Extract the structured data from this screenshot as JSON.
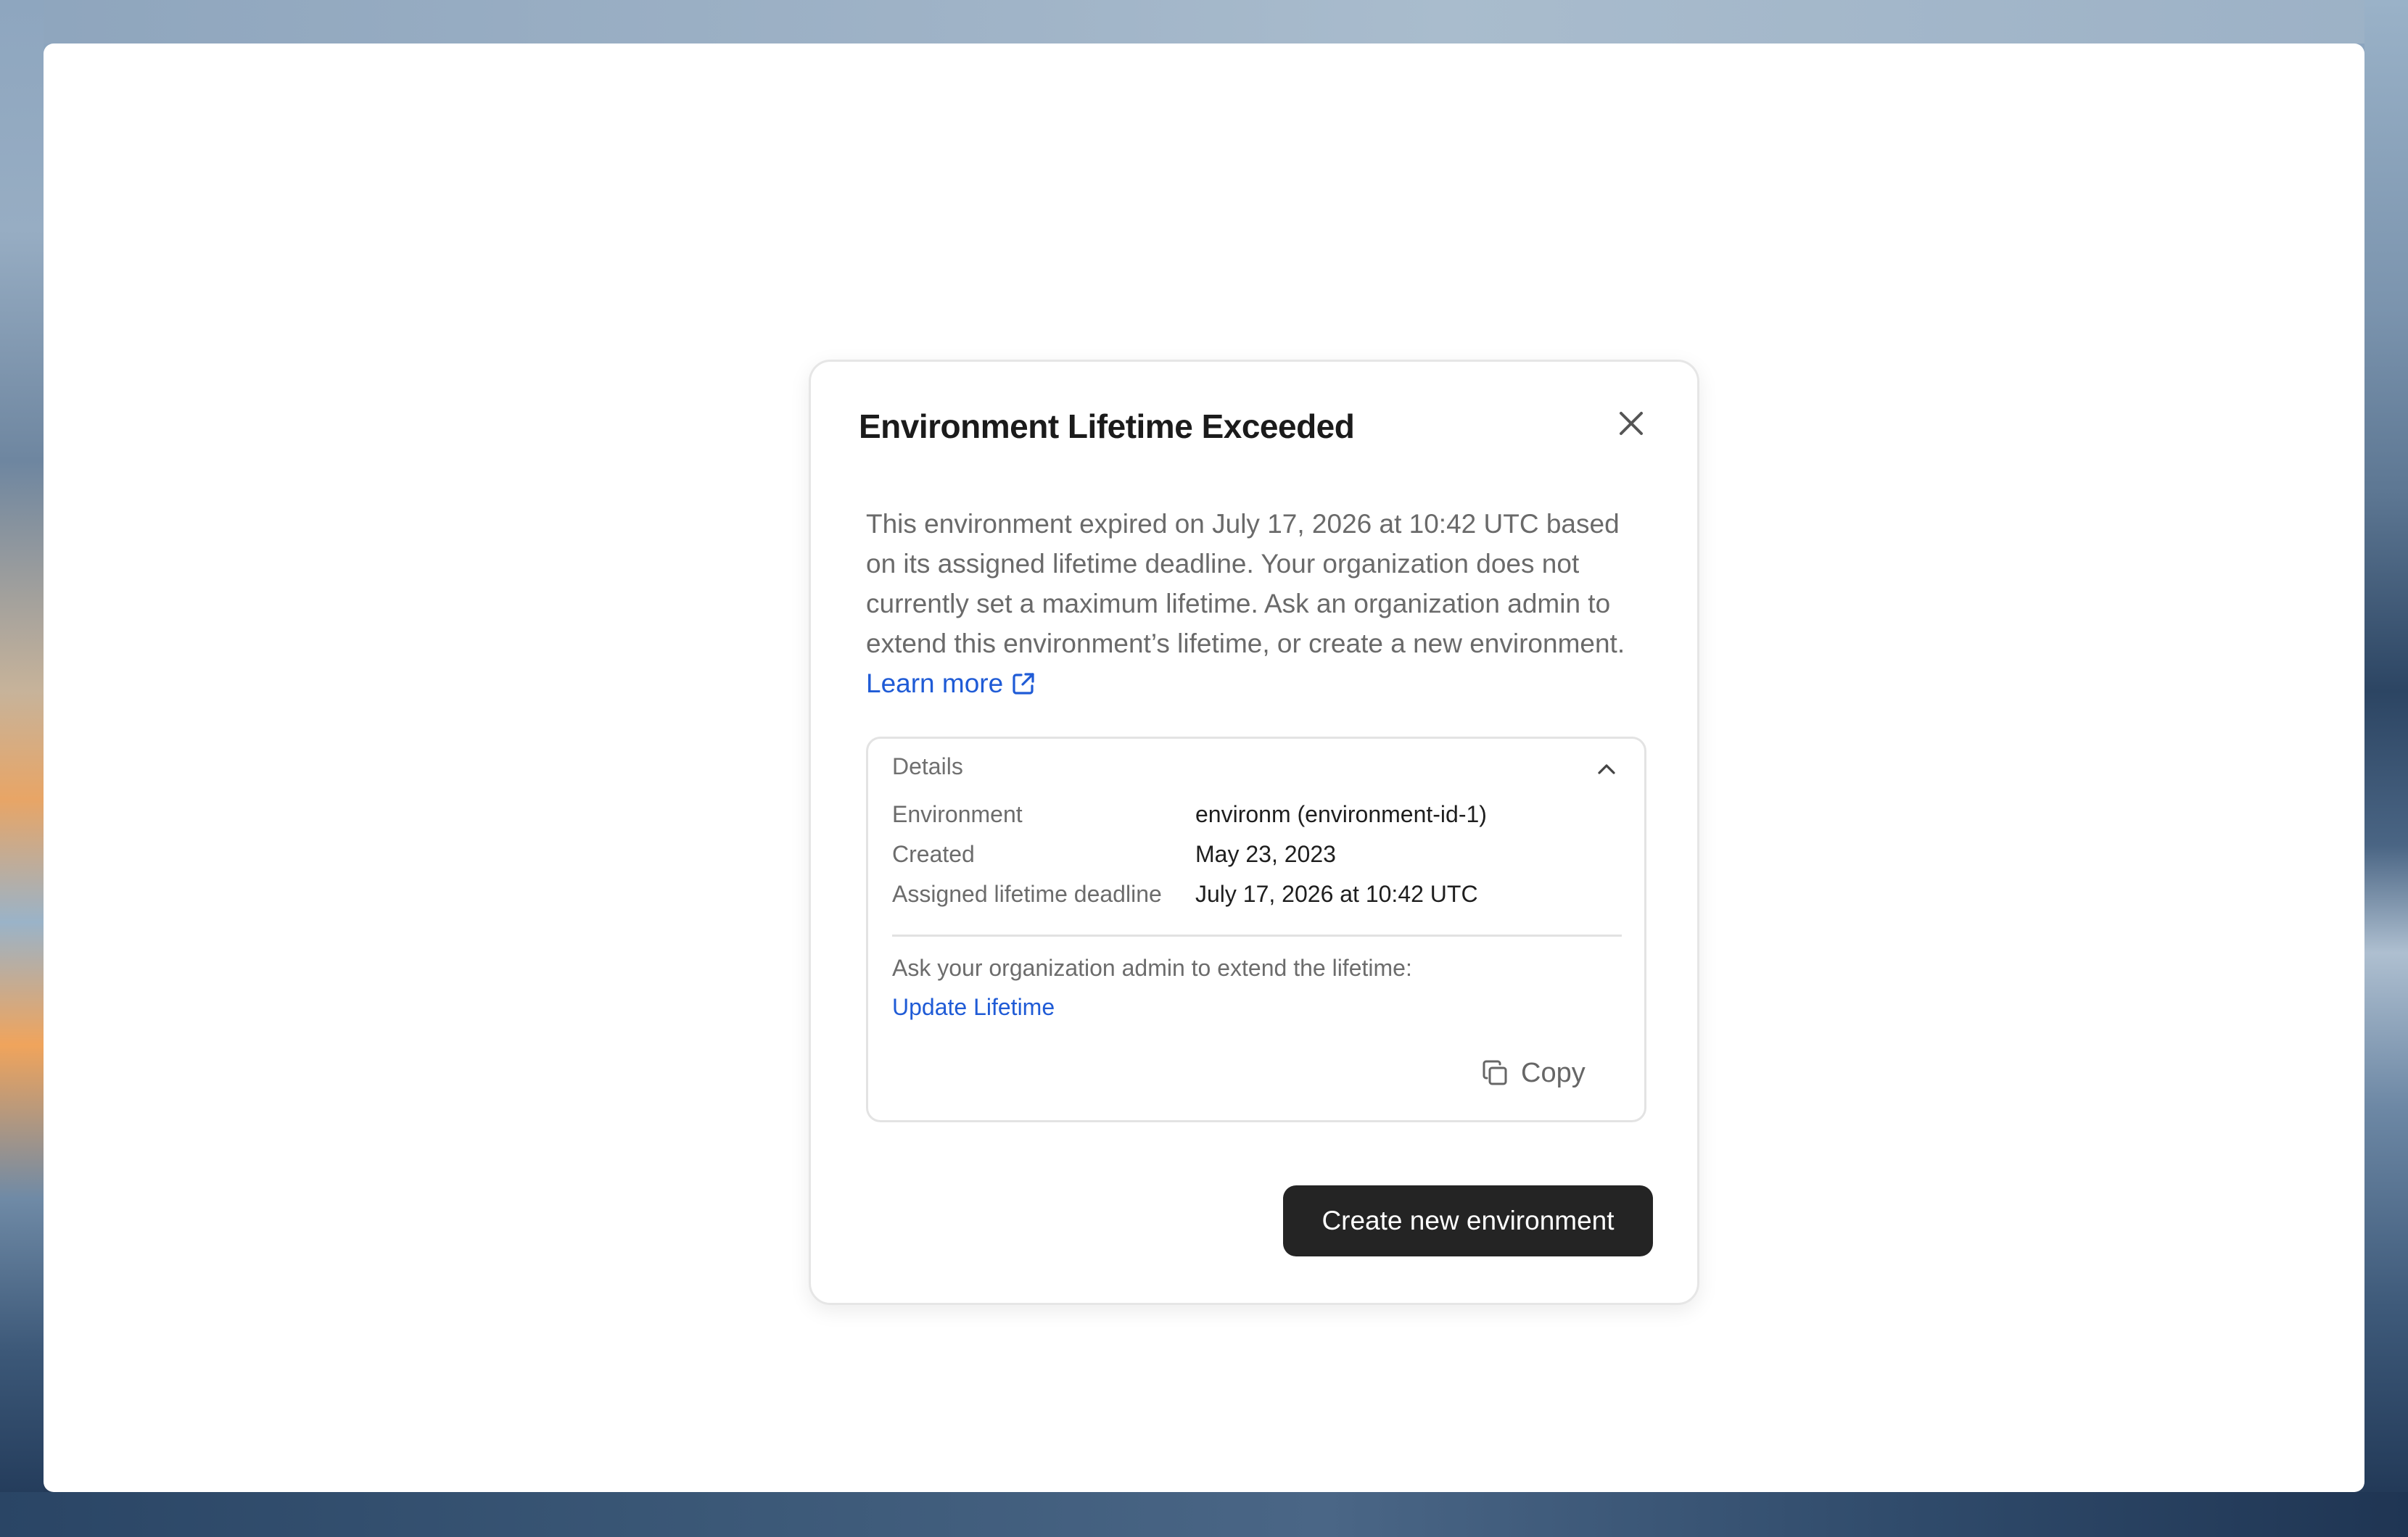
{
  "dialog": {
    "title": "Environment Lifetime Exceeded",
    "close_icon": "close-icon",
    "description": "This environment expired on July 17, 2026 at 10:42 UTC based on its assigned lifetime deadline. Your organization does not currently set a maximum lifetime. Ask an organization admin to extend this environment’s lifetime, or create a new environment.",
    "learn_more_label": "Learn more",
    "learn_more_icon": "external-link-icon"
  },
  "details": {
    "header": "Details",
    "toggle_icon": "chevron-up-icon",
    "rows": [
      {
        "label": "Environment",
        "value": "environm (environment-id-1)"
      },
      {
        "label": "Created",
        "value": "May 23, 2023"
      },
      {
        "label": "Assigned lifetime deadline",
        "value": "July 17, 2026 at 10:42 UTC"
      }
    ],
    "ask_text": "Ask your organization admin to extend the lifetime:",
    "update_link_label": "Update Lifetime",
    "copy_label": "Copy",
    "copy_icon": "copy-icon"
  },
  "actions": {
    "create_label": "Create new environment"
  },
  "colors": {
    "link": "#1f5bd6",
    "primary_button": "#242424",
    "title_text": "#1b1b1b",
    "muted_text": "#6a6a6a"
  }
}
